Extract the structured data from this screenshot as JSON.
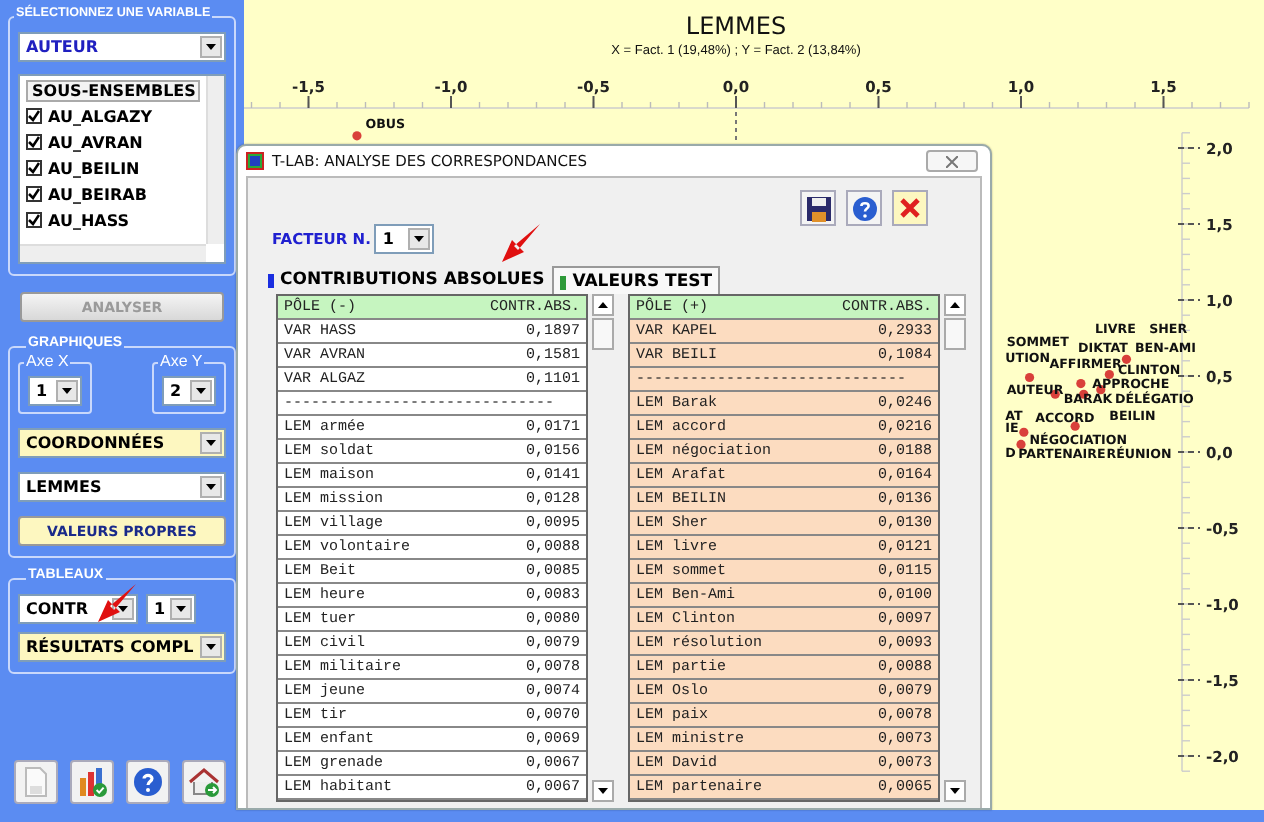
{
  "sidebar": {
    "variable_group": {
      "title": "SÉLECTIONNEZ UNE VARIABLE",
      "select": "AUTEUR",
      "list": {
        "header": "SOUS-ENSEMBLES",
        "items": [
          {
            "label": "AU_ALGAZY",
            "checked": true
          },
          {
            "label": "AU_AVRAN",
            "checked": true
          },
          {
            "label": "AU_BEILIN",
            "checked": true
          },
          {
            "label": "AU_BEIRAB",
            "checked": true
          },
          {
            "label": "AU_HASS",
            "checked": true
          }
        ]
      }
    },
    "analyze_button": {
      "label": "ANALYSER",
      "disabled": true
    },
    "graphics_group": {
      "title": "GRAPHIQUES",
      "axis_x": {
        "label": "Axe X",
        "value": "1"
      },
      "axis_y": {
        "label": "Axe Y",
        "value": "2"
      },
      "coordinates_select": "COORDONNÉES",
      "lemmas_select": "LEMMES",
      "eigenvalues_button": "VALEURS PROPRES"
    },
    "tables_group": {
      "title": "TABLEAUX",
      "table_select": "CONTR",
      "factor_select": "1",
      "results_select": "RÉSULTATS COMPL"
    }
  },
  "plot": {
    "title": "LEMMES",
    "subtitle": "X = Fact. 1 (19,48%) ; Y = Fact. 2 (13,84%)",
    "chart_data": {
      "type": "scatter",
      "xticks": [
        {
          "value": -1.5,
          "label": "-1,5"
        },
        {
          "value": -1,
          "label": "-1,0"
        },
        {
          "value": -0.5,
          "label": "-0,5"
        },
        {
          "value": 0,
          "label": "0,0"
        },
        {
          "value": 0.5,
          "label": "0,5"
        },
        {
          "value": 1,
          "label": "1,0"
        },
        {
          "value": 1.5,
          "label": "1,5"
        }
      ],
      "yticks": [
        {
          "value": 2,
          "label": "2,0"
        },
        {
          "value": 1.5,
          "label": "1,5"
        },
        {
          "value": 1,
          "label": "1,0"
        },
        {
          "value": 0.5,
          "label": "0,5"
        },
        {
          "value": 0,
          "label": "0,0"
        },
        {
          "value": -0.5,
          "label": "-0,5"
        },
        {
          "value": -1,
          "label": "-1,0"
        },
        {
          "value": -1.5,
          "label": "-1,5"
        },
        {
          "value": -2,
          "label": "-2,0"
        }
      ],
      "x": [
        -1.33,
        1.37,
        1.03,
        1.31,
        1.21,
        1.22,
        1.28,
        1.12,
        1.19,
        1.01,
        1.0
      ],
      "xlim": [
        -1.8,
        1.8
      ],
      "ylim": [
        -2.1,
        2.1
      ],
      "series": [
        {
          "color": "#d9403a",
          "values": [
            2.08,
            0.61,
            0.49,
            0.51,
            0.45,
            0.38,
            0.41,
            0.38,
            0.17,
            0.13,
            0.05
          ]
        }
      ],
      "annotations": [
        "OBUS",
        "SOMMET",
        "LIVRE",
        "SHER",
        "DIKTAT",
        "BEN-AMI",
        "UTION",
        "AFFIRMER",
        "CLINTON",
        "APPROCHE",
        "AUTEUR",
        "BARAK",
        "DÉLÉGATIO",
        "AT",
        "ACCORD",
        "BEILIN",
        "IE",
        "NÉGOCIATION",
        "D",
        "PARTENAIRE",
        "RÉUNION"
      ]
    }
  },
  "dialog": {
    "title": "T-LAB: ANALYSE DES CORRESPONDANCES",
    "factor_label": "FACTEUR N.",
    "factor_value": "1",
    "tabs": [
      {
        "label": "CONTRIBUTIONS ABSOLUES",
        "selected": true,
        "color": "#1a2ee0"
      },
      {
        "label": "VALEURS TEST",
        "selected": false,
        "color": "#2e9a3a"
      }
    ],
    "tables": [
      {
        "header": [
          "PÔLE (-)",
          "CONTR.ABS."
        ],
        "rows": [
          {
            "kind": "entry",
            "label": "VAR HASS",
            "value": "0,1897"
          },
          {
            "kind": "entry",
            "label": "VAR AVRAN",
            "value": "0,1581"
          },
          {
            "kind": "entry",
            "label": "VAR ALGAZ",
            "value": "0,1101"
          },
          {
            "kind": "separator",
            "text": "------------------------------"
          },
          {
            "kind": "entry",
            "label": "LEM armée",
            "value": "0,0171"
          },
          {
            "kind": "entry",
            "label": "LEM soldat",
            "value": "0,0156"
          },
          {
            "kind": "entry",
            "label": "LEM maison",
            "value": "0,0141"
          },
          {
            "kind": "entry",
            "label": "LEM mission",
            "value": "0,0128"
          },
          {
            "kind": "entry",
            "label": "LEM village",
            "value": "0,0095"
          },
          {
            "kind": "entry",
            "label": "LEM volontaire",
            "value": "0,0088"
          },
          {
            "kind": "entry",
            "label": "LEM Beit",
            "value": "0,0085"
          },
          {
            "kind": "entry",
            "label": "LEM heure",
            "value": "0,0083"
          },
          {
            "kind": "entry",
            "label": "LEM tuer",
            "value": "0,0080"
          },
          {
            "kind": "entry",
            "label": "LEM civil",
            "value": "0,0079"
          },
          {
            "kind": "entry",
            "label": "LEM militaire",
            "value": "0,0078"
          },
          {
            "kind": "entry",
            "label": "LEM jeune",
            "value": "0,0074"
          },
          {
            "kind": "entry",
            "label": "LEM tir",
            "value": "0,0070"
          },
          {
            "kind": "entry",
            "label": "LEM enfant",
            "value": "0,0069"
          },
          {
            "kind": "entry",
            "label": "LEM grenade",
            "value": "0,0067"
          },
          {
            "kind": "entry",
            "label": "LEM habitant",
            "value": "0,0067"
          }
        ]
      },
      {
        "header": [
          "PÔLE (+)",
          "CONTR.ABS."
        ],
        "rows": [
          {
            "kind": "entry",
            "label": "VAR KAPEL",
            "value": "0,2933"
          },
          {
            "kind": "entry",
            "label": "VAR BEILI",
            "value": "0,1084"
          },
          {
            "kind": "separator",
            "text": "------------------------------"
          },
          {
            "kind": "entry",
            "label": "LEM Barak",
            "value": "0,0246"
          },
          {
            "kind": "entry",
            "label": "LEM accord",
            "value": "0,0216"
          },
          {
            "kind": "entry",
            "label": "LEM négociation",
            "value": "0,0188"
          },
          {
            "kind": "entry",
            "label": "LEM Arafat",
            "value": "0,0164"
          },
          {
            "kind": "entry",
            "label": "LEM BEILIN",
            "value": "0,0136"
          },
          {
            "kind": "entry",
            "label": "LEM Sher",
            "value": "0,0130"
          },
          {
            "kind": "entry",
            "label": "LEM livre",
            "value": "0,0121"
          },
          {
            "kind": "entry",
            "label": "LEM sommet",
            "value": "0,0115"
          },
          {
            "kind": "entry",
            "label": "LEM Ben-Ami",
            "value": "0,0100"
          },
          {
            "kind": "entry",
            "label": "LEM Clinton",
            "value": "0,0097"
          },
          {
            "kind": "entry",
            "label": "LEM résolution",
            "value": "0,0093"
          },
          {
            "kind": "entry",
            "label": "LEM partie",
            "value": "0,0088"
          },
          {
            "kind": "entry",
            "label": "LEM Oslo",
            "value": "0,0079"
          },
          {
            "kind": "entry",
            "label": "LEM paix",
            "value": "0,0078"
          },
          {
            "kind": "entry",
            "label": "LEM ministre",
            "value": "0,0073"
          },
          {
            "kind": "entry",
            "label": "LEM David",
            "value": "0,0073"
          },
          {
            "kind": "entry",
            "label": "LEM partenaire",
            "value": "0,0065"
          }
        ]
      }
    ]
  }
}
